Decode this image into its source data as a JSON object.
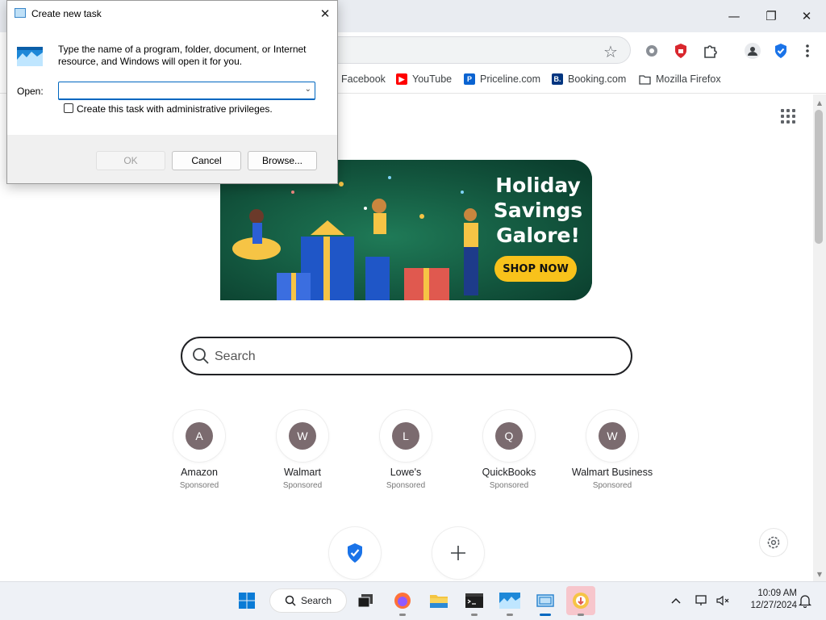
{
  "dialog": {
    "title": "Create new task",
    "description": "Type the name of a program, folder, document, or Internet resource, and Windows will open it for you.",
    "open_label": "Open:",
    "open_value": "",
    "admin_checkbox_label": "Create this task with administrative privileges.",
    "admin_checked": false,
    "ok_label": "OK",
    "cancel_label": "Cancel",
    "browse_label": "Browse..."
  },
  "browser": {
    "bookmarks": [
      {
        "label": "Facebook",
        "icon": "facebook-icon"
      },
      {
        "label": "YouTube",
        "icon": "youtube-icon",
        "color": "#ff0000"
      },
      {
        "label": "Priceline.com",
        "icon": "priceline-icon",
        "color": "#0a63d1"
      },
      {
        "label": "Booking.com",
        "icon": "booking-icon",
        "color": "#003580"
      },
      {
        "label": "Mozilla Firefox",
        "icon": "folder-icon"
      }
    ]
  },
  "page": {
    "banner": {
      "headline_1": "Holiday",
      "headline_2": "Savings",
      "headline_3": "Galore!",
      "cta": "SHOP NOW"
    },
    "search_placeholder": "Search",
    "tiles": [
      {
        "letter": "A",
        "name": "Amazon",
        "tag": "Sponsored"
      },
      {
        "letter": "W",
        "name": "Walmart",
        "tag": "Sponsored"
      },
      {
        "letter": "L",
        "name": "Lowe's",
        "tag": "Sponsored"
      },
      {
        "letter": "Q",
        "name": "QuickBooks",
        "tag": "Sponsored"
      },
      {
        "letter": "W",
        "name": "Walmart Business",
        "tag": "Sponsored"
      }
    ]
  },
  "taskbar": {
    "search_label": "Search",
    "time": "10:09 AM",
    "date": "12/27/2024"
  },
  "colors": {
    "accent": "#0067c0",
    "banner_green": "#0e4a36",
    "cta_yellow": "#f8c21b",
    "tile_avatar": "#7b6b6f"
  }
}
